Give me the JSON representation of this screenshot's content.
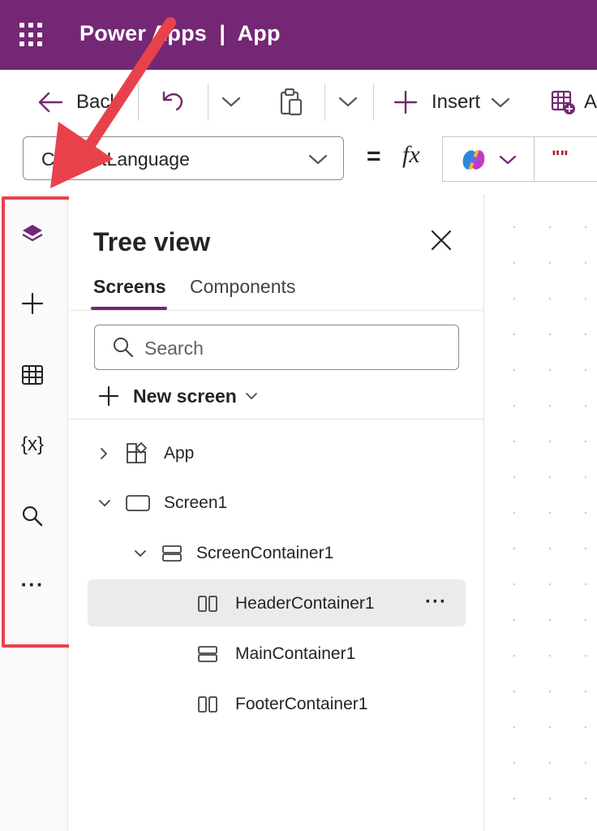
{
  "header": {
    "title": "Power Apps  |  App"
  },
  "commandbar": {
    "back_label": "Back",
    "insert_label": "Insert",
    "cut_label": "A"
  },
  "formula": {
    "property": "ContentLanguage",
    "equals": "=",
    "fx": "fx",
    "value": "\"\""
  },
  "treeview": {
    "title": "Tree view",
    "tabs": [
      "Screens",
      "Components"
    ],
    "search_placeholder": "Search",
    "new_screen_label": "New screen",
    "nodes": [
      {
        "label": "App"
      },
      {
        "label": "Screen1"
      },
      {
        "label": "ScreenContainer1"
      },
      {
        "label": "HeaderContainer1"
      },
      {
        "label": "MainContainer1"
      },
      {
        "label": "FooterContainer1"
      }
    ],
    "more": "···"
  },
  "rail": {
    "more": "···",
    "variables": "{x}"
  },
  "colors": {
    "brand": "#742774",
    "highlight": "#e9414c",
    "selected_row": "#ebebeb"
  }
}
